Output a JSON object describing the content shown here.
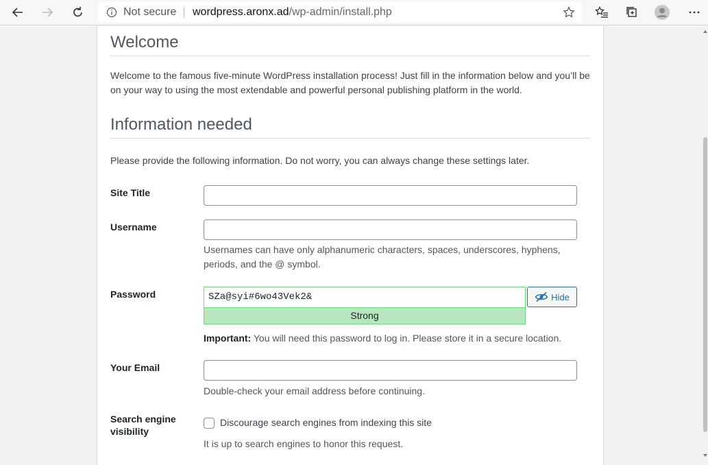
{
  "browser": {
    "security_label": "Not secure",
    "url_host": "wordpress.aronx.ad",
    "url_path": "/wp-admin/install.php"
  },
  "page": {
    "welcome_heading": "Welcome",
    "welcome_text": "Welcome to the famous five-minute WordPress installation process! Just fill in the information below and you’ll be on your way to using the most extendable and powerful personal publishing platform in the world.",
    "info_heading": "Information needed",
    "info_text": "Please provide the following information. Do not worry, you can always change these settings later."
  },
  "form": {
    "site_title": {
      "label": "Site Title",
      "value": ""
    },
    "username": {
      "label": "Username",
      "value": "",
      "hint": "Usernames can have only alphanumeric characters, spaces, underscores, hyphens, periods, and the @ symbol."
    },
    "password": {
      "label": "Password",
      "value": "SZa@syi#6wo43Vek2&",
      "strength": "Strong",
      "hide_label": "Hide",
      "important_label": "Important:",
      "important_text": " You will need this password to log in. Please store it in a secure location."
    },
    "email": {
      "label": "Your Email",
      "value": "",
      "hint": "Double-check your email address before continuing."
    },
    "visibility": {
      "label_line1": "Search engine",
      "label_line2": "visibility",
      "checkbox_label": "Discourage search engines from indexing this site",
      "checked": false,
      "hint": "It is up to search engines to honor this request."
    }
  },
  "colors": {
    "accent": "#2271b1",
    "strength_bg": "#b8e6bf",
    "strength_border": "#68de7c"
  }
}
